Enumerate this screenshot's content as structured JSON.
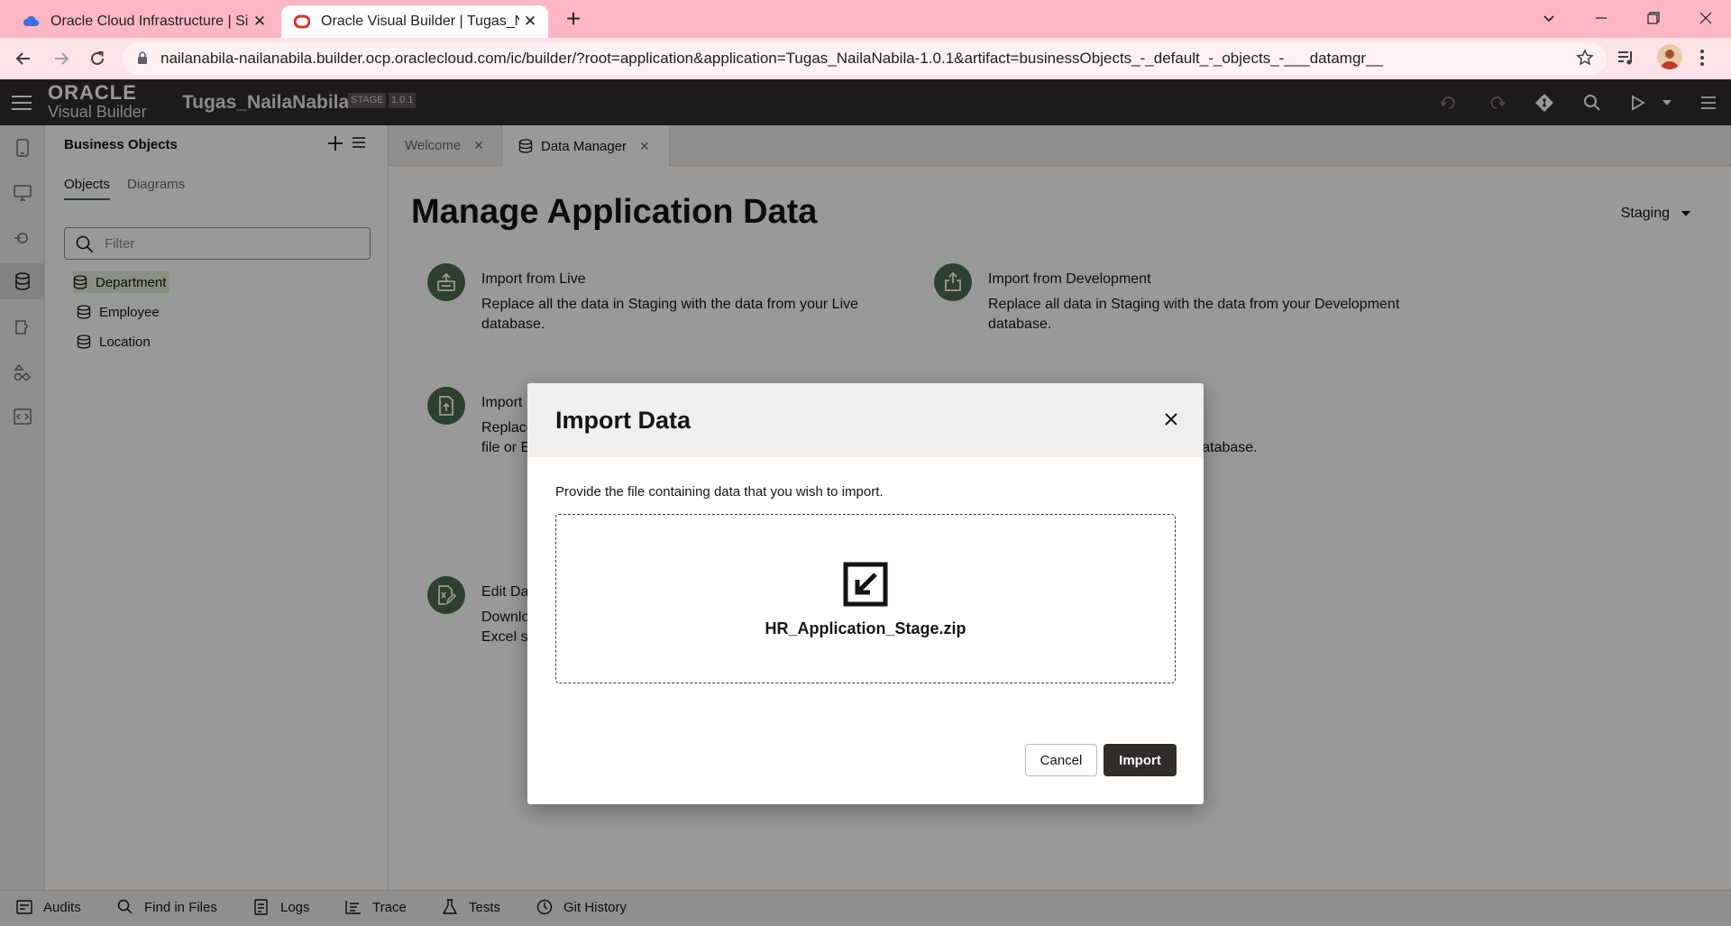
{
  "browser": {
    "tabs": [
      {
        "title": "Oracle Cloud Infrastructure | Sign In",
        "favicon": "cloud-icon"
      },
      {
        "title": "Oracle Visual Builder | Tugas_NailaNabila",
        "favicon": "oracle-icon"
      }
    ],
    "url": "nailanabila-nailanabila.builder.ocp.oraclecloud.com/ic/builder/?root=application&application=Tugas_NailaNabila-1.0.1&artifact=businessObjects_-_default_-_objects_-___datamgr__"
  },
  "header": {
    "logo_line1": "ORACLE",
    "logo_line2": "Visual Builder",
    "app_name": "Tugas_NailaNabila",
    "stage_badge": "STAGE",
    "version_badge": "1.0.1"
  },
  "navigator": {
    "title": "Business Objects",
    "tabs": [
      "Objects",
      "Diagrams"
    ],
    "filter_placeholder": "Filter",
    "items": [
      "Department",
      "Employee",
      "Location"
    ]
  },
  "editor_tabs": [
    "Welcome",
    "Data Manager"
  ],
  "main": {
    "title": "Manage Application Data",
    "environment": "Staging",
    "cards": [
      {
        "heading": "Import from Live",
        "desc": "Replace all the data in Staging with the data from your Live database."
      },
      {
        "heading": "Import from Development",
        "desc": "Replace all data in Staging with the data from your Development database."
      },
      {
        "heading": "Import",
        "desc1": "Replace",
        "desc2": "file or E"
      },
      {
        "desc_tail": "g database."
      },
      {
        "heading": "Edit Da",
        "desc1": "Downlo",
        "desc2": "Excel s"
      }
    ]
  },
  "bottom_bar": [
    "Audits",
    "Find in Files",
    "Logs",
    "Trace",
    "Tests",
    "Git History"
  ],
  "dialog": {
    "title": "Import Data",
    "message": "Provide the file containing data that you wish to import.",
    "file_name": "HR_Application_Stage.zip",
    "cancel_label": "Cancel",
    "import_label": "Import"
  },
  "colors": {
    "tab_strip": "#fdb7c4",
    "app_header": "#312d2a",
    "accent_green": "#4d6b50",
    "primary_button": "#312d2a"
  }
}
